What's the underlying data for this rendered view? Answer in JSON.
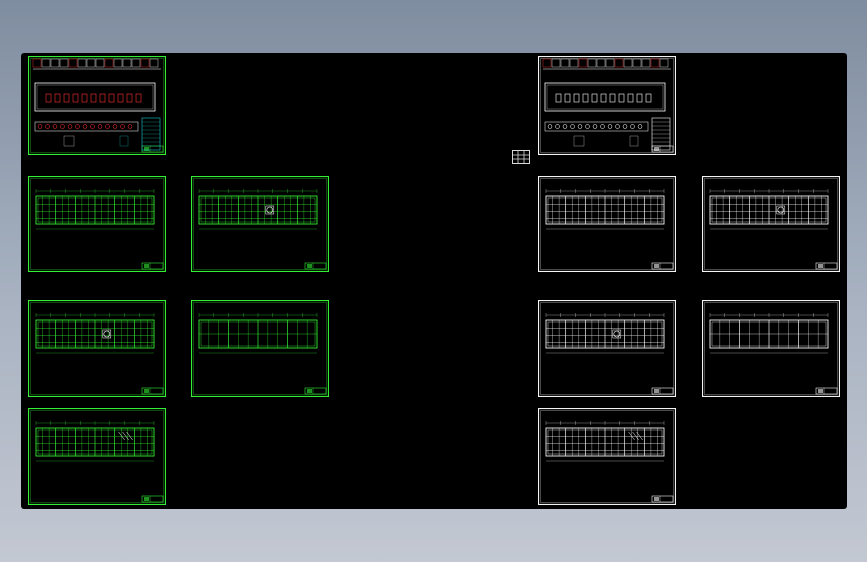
{
  "canvas": {
    "background": "#000000",
    "line_colors": {
      "green": "#33ee33",
      "white": "#f4f4f4",
      "red": "#ff3030",
      "cyan": "#18c8c8",
      "yellow": "#e8e820"
    }
  },
  "sheets": [
    {
      "id": "s1",
      "style": "green",
      "kind": "overview"
    },
    {
      "id": "s2",
      "style": "green",
      "kind": "elevation",
      "variant": 1
    },
    {
      "id": "s3",
      "style": "green",
      "kind": "elevation",
      "variant": 2
    },
    {
      "id": "s4",
      "style": "green",
      "kind": "elevation",
      "variant": 3
    },
    {
      "id": "s5",
      "style": "green",
      "kind": "elevation",
      "variant": 4
    },
    {
      "id": "s6",
      "style": "green",
      "kind": "elevation",
      "variant": 5
    },
    {
      "id": "s7",
      "style": "white",
      "kind": "overview"
    },
    {
      "id": "s8",
      "style": "white",
      "kind": "elevation",
      "variant": 1
    },
    {
      "id": "s9",
      "style": "white",
      "kind": "elevation",
      "variant": 2
    },
    {
      "id": "s10",
      "style": "white",
      "kind": "elevation",
      "variant": 3
    },
    {
      "id": "s11",
      "style": "white",
      "kind": "elevation",
      "variant": 4
    },
    {
      "id": "s12",
      "style": "white",
      "kind": "elevation",
      "variant": 5
    }
  ],
  "view_cube": {
    "icon": "view-cube-icon"
  }
}
